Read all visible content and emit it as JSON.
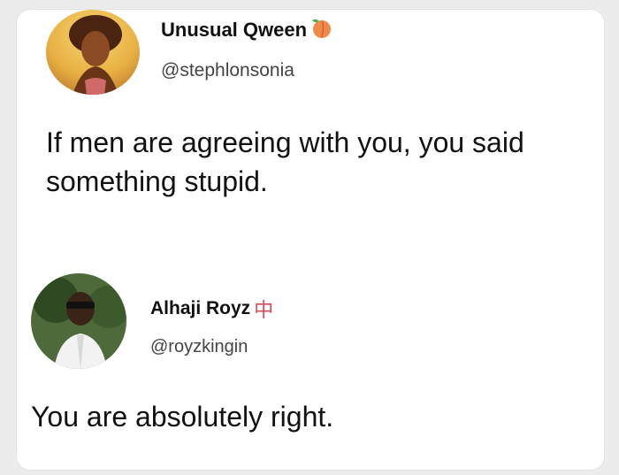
{
  "tweet": {
    "author": {
      "display_name": "Unusual Qween",
      "handle": "@stephlonsonia",
      "name_emoji": "peach-emoji"
    },
    "text_line1": "If men are agreeing with you, you said",
    "text_line2": "something stupid."
  },
  "reply": {
    "author": {
      "display_name": "Alhaji Royz",
      "handle": "@royzkingin",
      "name_emoji": "mahjong-red-dragon-emoji"
    },
    "text": "You are absolutely right."
  },
  "colors": {
    "background": "#ececec",
    "card": "#ffffff",
    "text": "#111111",
    "handle": "#444444"
  }
}
